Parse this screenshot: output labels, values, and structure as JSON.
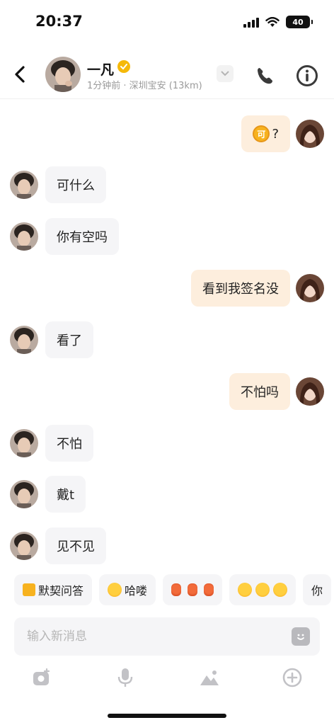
{
  "status_bar": {
    "time": "20:37",
    "battery": "40"
  },
  "header": {
    "contact_name": "一凡",
    "meta": "1分钟前 · 深圳宝安 (13km)"
  },
  "messages": [
    {
      "side": "out",
      "text": "?",
      "has_coin": true,
      "coin_label": "可"
    },
    {
      "side": "in",
      "text": "可什么"
    },
    {
      "side": "in",
      "text": "你有空吗"
    },
    {
      "side": "out",
      "text": "看到我签名没"
    },
    {
      "side": "in",
      "text": "看了"
    },
    {
      "side": "out",
      "text": "不怕吗"
    },
    {
      "side": "in",
      "text": "不怕"
    },
    {
      "side": "in",
      "text": "戴t"
    },
    {
      "side": "in",
      "text": "见不见"
    }
  ],
  "quick_replies": [
    {
      "label": "默契问答",
      "icon": "note-icon"
    },
    {
      "label": "哈喽",
      "icon": "monkey-emoji-icon"
    },
    {
      "label": "",
      "icon": "red-envelope-emoji-icon"
    },
    {
      "label": "",
      "icon": "hands-emoji-icon"
    },
    {
      "label": "你",
      "icon": ""
    }
  ],
  "input": {
    "placeholder": "输入新消息"
  },
  "colors": {
    "outgoing_bubble": "#fdeedd",
    "incoming_bubble": "#f5f5f7",
    "verified": "#f5b90a"
  }
}
